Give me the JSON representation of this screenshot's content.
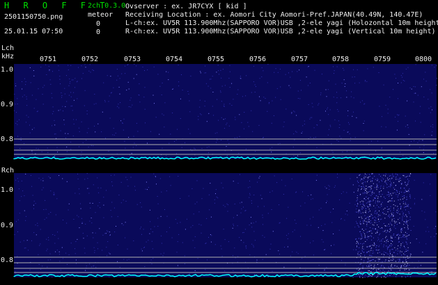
{
  "header": {
    "title": "H R O F F T",
    "filename": "2501150750.png",
    "datetime": "25.01.15 07:50",
    "mode": "2ch 0.3.0",
    "meteor_label": "meteor",
    "count_l": "0",
    "count_r": "0",
    "info": [
      "Ovserver            : ex. JR7CYX [ kid ]",
      "Receiving Location : ex. Aomori City Aomori-Pref.JAPAN(40.49N, 140.47E)",
      "L-ch:ex. UV5R 113.900Mhz(SAPPORO VOR)USB ,2-ele yagi (Holozontal 10m height)",
      "R-ch:ex. UV5R 113.900Mhz(SAPPORO VOR)USB ,2-ele yagi (Vertical 10m height)"
    ]
  },
  "time_ticks": [
    "0751",
    "0752",
    "0753",
    "0754",
    "0755",
    "0756",
    "0757",
    "0758",
    "0759",
    "0800"
  ],
  "left_panel": {
    "channel": "Lch",
    "unit": "kHz",
    "yticks": [
      "1.0",
      "0.9",
      "0.8"
    ]
  },
  "right_panel": {
    "channel": "Rch",
    "yticks": [
      "1.0",
      "0.9",
      "0.8"
    ]
  },
  "colors": {
    "background": "#000000",
    "waterfall": "#0a0a5a",
    "trace": "#00ffff",
    "title": "#00e000"
  }
}
